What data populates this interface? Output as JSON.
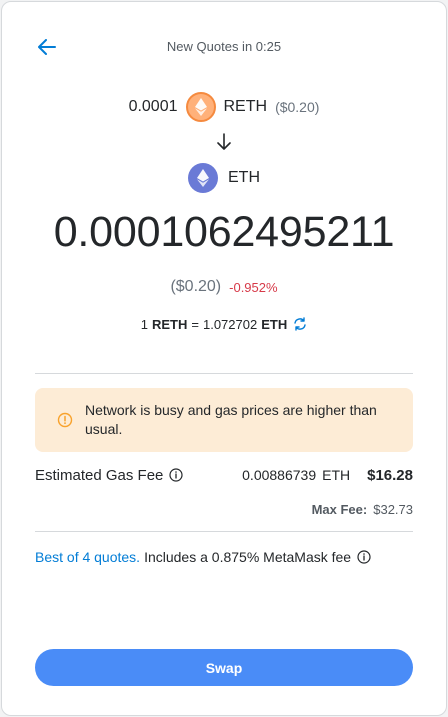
{
  "header": {
    "quote_timer": "New Quotes in 0:25"
  },
  "source": {
    "amount": "0.0001",
    "symbol": "RETH",
    "fiat": "($0.20)",
    "icon": "reth-token-icon"
  },
  "destination": {
    "symbol": "ETH",
    "icon": "eth-token-icon",
    "amount": "0.0001062495211",
    "fiat": "($0.20)",
    "price_change": "-0.952%"
  },
  "rate": {
    "prefix": "1",
    "from_symbol": "RETH",
    "equals": "=",
    "value": "1.072702",
    "to_symbol": "ETH"
  },
  "warning": {
    "text": "Network is busy and gas prices are higher than usual."
  },
  "gas": {
    "label": "Estimated Gas Fee",
    "eth_amount": "0.00886739",
    "eth_unit": "ETH",
    "fiat": "$16.28",
    "max_fee_label": "Max Fee:",
    "max_fee_value": "$32.73"
  },
  "quotes": {
    "link_text": "Best of 4 quotes.",
    "rest_text": "Includes a 0.875% MetaMask fee"
  },
  "actions": {
    "swap_label": "Swap"
  },
  "colors": {
    "accent_blue": "#037dd6",
    "swap_button": "#4a8cf7",
    "warning_bg": "#fdecd6",
    "negative": "#d73a49"
  }
}
